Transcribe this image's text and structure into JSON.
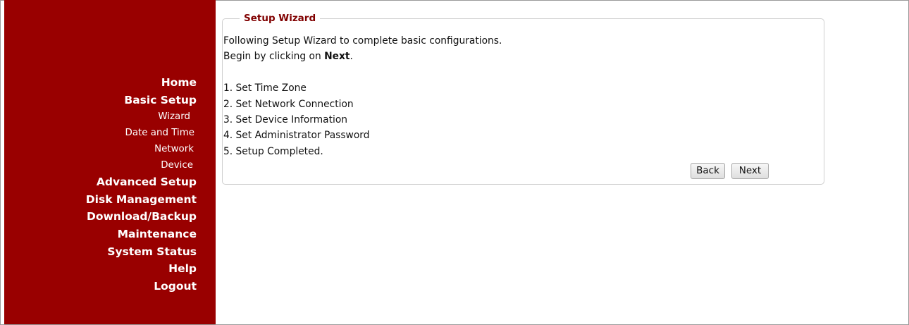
{
  "sidebar": {
    "items": [
      {
        "label": "Home",
        "level": "main"
      },
      {
        "label": "Basic Setup",
        "level": "main"
      },
      {
        "label": "Wizard",
        "level": "sub"
      },
      {
        "label": "Date and Time",
        "level": "sub"
      },
      {
        "label": "Network",
        "level": "sub"
      },
      {
        "label": "Device",
        "level": "sub"
      },
      {
        "label": "Advanced Setup",
        "level": "main"
      },
      {
        "label": "Disk Management",
        "level": "main"
      },
      {
        "label": "Download/Backup",
        "level": "main"
      },
      {
        "label": "Maintenance",
        "level": "main"
      },
      {
        "label": "System Status",
        "level": "main"
      },
      {
        "label": "Help",
        "level": "main"
      },
      {
        "label": "Logout",
        "level": "main"
      }
    ],
    "background_color": "#990000"
  },
  "wizard": {
    "legend": "Setup Wizard",
    "intro_line1": "Following Setup Wizard to complete basic configurations.",
    "intro_line2_prefix": "Begin by clicking on ",
    "intro_line2_bold": "Next",
    "intro_line2_suffix": ".",
    "steps": [
      "1. Set Time Zone",
      "2. Set Network Connection",
      "3. Set Device Information",
      "4. Set Administrator Password",
      "5. Setup Completed."
    ],
    "back_label": "Back",
    "next_label": "Next",
    "legend_color": "#800000"
  }
}
